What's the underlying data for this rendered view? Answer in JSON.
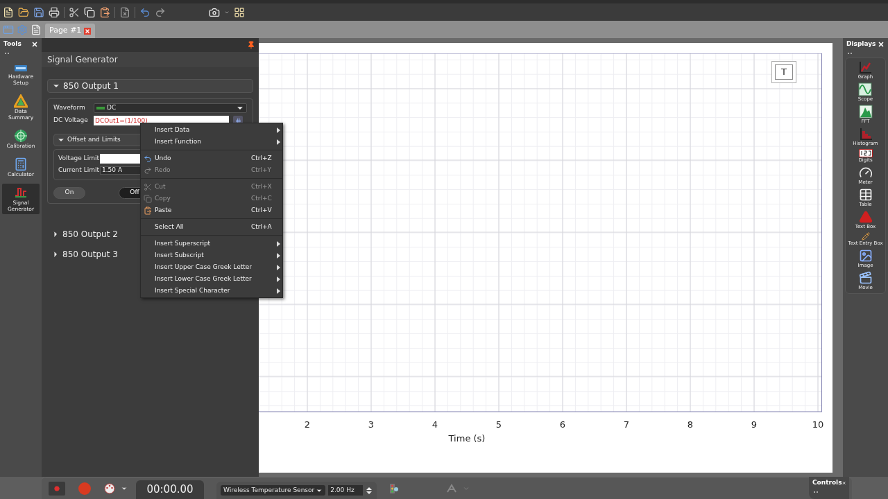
{
  "tabs": [
    {
      "label": "Page #1",
      "selected": true
    }
  ],
  "tools_panel": {
    "title": "Tools",
    "items": [
      {
        "label": "Hardware Setup",
        "selected": false
      },
      {
        "label": "Data Summary",
        "selected": false
      },
      {
        "label": "Calibration",
        "selected": false
      },
      {
        "label": "Calculator",
        "selected": false
      },
      {
        "label": "Signal Generator",
        "selected": true
      }
    ]
  },
  "signal_generator": {
    "title": "Signal Generator",
    "outputs": [
      {
        "label": "850 Output 1",
        "expanded": true,
        "waveform_label": "Waveform",
        "waveform": "DC",
        "dc_voltage_label": "DC Voltage",
        "dc_voltage": "DCOut1=(1/100)",
        "offset_section": {
          "label": "Offset and Limits",
          "expanded": true
        },
        "voltage_limit_label": "Voltage Limit",
        "current_limit_label": "Current Limit",
        "current_limit": "1.50 A",
        "switch": [
          {
            "label": "On",
            "selected": false
          },
          {
            "label": "Off",
            "selected": true
          }
        ]
      },
      {
        "label": "850 Output 2",
        "expanded": false
      },
      {
        "label": "850 Output 3",
        "expanded": false
      }
    ]
  },
  "context_menu": {
    "items": [
      {
        "kind": "item",
        "label": "Insert Data",
        "submenu": true,
        "disabled": false
      },
      {
        "kind": "item",
        "label": "Insert Function",
        "submenu": true,
        "disabled": false
      },
      {
        "kind": "separator"
      },
      {
        "kind": "item",
        "label": "Undo",
        "shortcut": "Ctrl+Z",
        "disabled": false
      },
      {
        "kind": "item",
        "label": "Redo",
        "shortcut": "Ctrl+Y",
        "disabled": true
      },
      {
        "kind": "separator"
      },
      {
        "kind": "item",
        "label": "Cut",
        "shortcut": "Ctrl+X",
        "disabled": true
      },
      {
        "kind": "item",
        "label": "Copy",
        "shortcut": "Ctrl+C",
        "disabled": true
      },
      {
        "kind": "item",
        "label": "Paste",
        "shortcut": "Ctrl+V",
        "disabled": false
      },
      {
        "kind": "separator"
      },
      {
        "kind": "item",
        "label": "Select All",
        "shortcut": "Ctrl+A",
        "disabled": false
      },
      {
        "kind": "separator"
      },
      {
        "kind": "item",
        "label": "Insert Superscript",
        "submenu": true,
        "disabled": false
      },
      {
        "kind": "item",
        "label": "Insert Subscript",
        "submenu": true,
        "disabled": false
      },
      {
        "kind": "item",
        "label": "Insert Upper Case Greek Letter",
        "submenu": true,
        "disabled": false
      },
      {
        "kind": "item",
        "label": "Insert Lower Case Greek Letter",
        "submenu": true,
        "disabled": false
      },
      {
        "kind": "item",
        "label": "Insert Special Character",
        "submenu": true,
        "disabled": false
      }
    ]
  },
  "graph": {
    "tool_label": "T",
    "x_axis": {
      "title": "Time (s)",
      "ticks": [
        "2",
        "3",
        "4",
        "5",
        "6",
        "7",
        "8",
        "9",
        "10"
      ]
    }
  },
  "displays_panel": {
    "title": "Displays",
    "items": [
      {
        "label": "Graph"
      },
      {
        "label": "Scope"
      },
      {
        "label": "FFT"
      },
      {
        "label": "Histogram"
      },
      {
        "label": "Digits"
      },
      {
        "label": "Meter"
      },
      {
        "label": "Table"
      },
      {
        "label": "Text Box"
      },
      {
        "label": "Text Entry Box"
      },
      {
        "label": "Image"
      },
      {
        "label": "Movie"
      }
    ]
  },
  "controls_bar": {
    "time": "00:00.00",
    "sensor": "Wireless Temperature Sensor",
    "rate": "2.00 Hz"
  },
  "controls_panel": {
    "title": "Controls"
  }
}
